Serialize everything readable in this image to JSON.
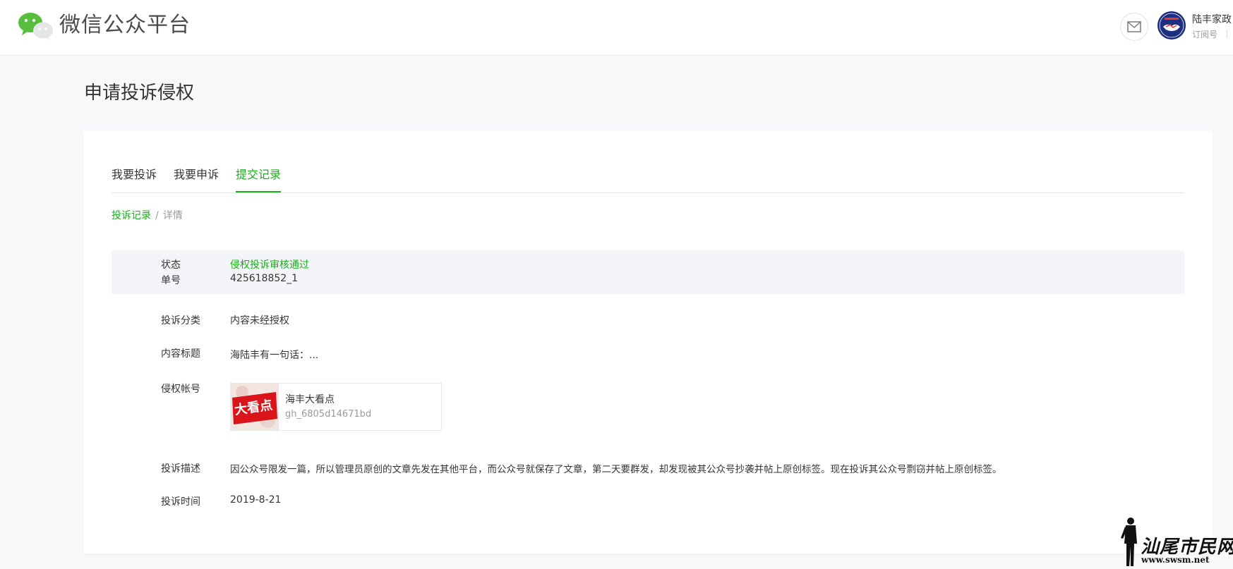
{
  "header": {
    "brand": "微信公众平台",
    "account_name": "陆丰家政",
    "account_type": "订阅号"
  },
  "page": {
    "title": "申请投诉侵权"
  },
  "tabs": [
    {
      "label": "我要投诉",
      "active": false
    },
    {
      "label": "我要申诉",
      "active": false
    },
    {
      "label": "提交记录",
      "active": true
    }
  ],
  "breadcrumb": {
    "parent": "投诉记录",
    "separator": "/",
    "current": "详情"
  },
  "detail": {
    "status_label": "状态",
    "status_value": "侵权投诉审核通过",
    "order_label": "单号",
    "order_value": "425618852_1",
    "category_label": "投诉分类",
    "category_value": "内容未经授权",
    "content_title_label": "内容标题",
    "content_title_value": "海陆丰有一句话：...",
    "infringing_account_label": "侵权帐号",
    "infringing_account_name": "海丰大看点",
    "infringing_account_id": "gh_6805d14671bd",
    "infringing_account_logo_text": "大看点",
    "description_label": "投诉描述",
    "description_value": "因公众号限发一篇，所以管理员原创的文章先发在其他平台，而公众号就保存了文章，第二天要群发，却发现被其公众号抄袭并帖上原创标签。现在投诉其公众号剽窃并帖上原创标签。",
    "time_label": "投诉时间",
    "time_value": "2019-8-21"
  },
  "watermark": {
    "text": "汕尾市民网",
    "url": "www.swsm.net"
  },
  "colors": {
    "accent": "#1aad19",
    "status_bg": "#f4f5f9",
    "page_bg": "#f6f8f9"
  },
  "icons": {
    "logo": "wechat-logo-icon",
    "mail": "mail-icon"
  }
}
